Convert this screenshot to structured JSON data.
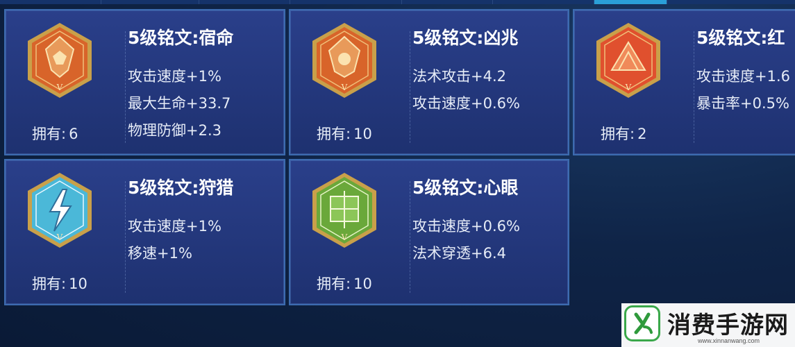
{
  "own_label": "拥有:",
  "inscriptions": [
    {
      "title": "5级铭文:宿命",
      "stats": [
        "攻击速度+1%",
        "最大生命+33.7",
        "物理防御+2.3"
      ],
      "owned": "6",
      "icon": "fate-inscription-icon",
      "color": "#d8642a",
      "level": "V"
    },
    {
      "title": "5级铭文:凶兆",
      "stats": [
        "法术攻击+4.2",
        "攻击速度+0.6%"
      ],
      "owned": "10",
      "icon": "omen-inscription-icon",
      "color": "#d8642a",
      "level": "V"
    },
    {
      "title": "5级铭文:红",
      "stats": [
        "攻击速度+1.6",
        "暴击率+0.5%"
      ],
      "owned": "2",
      "icon": "red-inscription-icon",
      "color": "#e0502e",
      "level": "V"
    },
    {
      "title": "5级铭文:狩猎",
      "stats": [
        "攻击速度+1%",
        "移速+1%"
      ],
      "owned": "10",
      "icon": "hunt-inscription-icon",
      "color": "#4bb8d8",
      "level": "V"
    },
    {
      "title": "5级铭文:心眼",
      "stats": [
        "攻击速度+0.6%",
        "法术穿透+6.4"
      ],
      "owned": "10",
      "icon": "mind-eye-inscription-icon",
      "color": "#6aa83a",
      "level": "V"
    }
  ],
  "watermark": {
    "name": "消费手游网",
    "url": "www.xinnanwang.com"
  }
}
